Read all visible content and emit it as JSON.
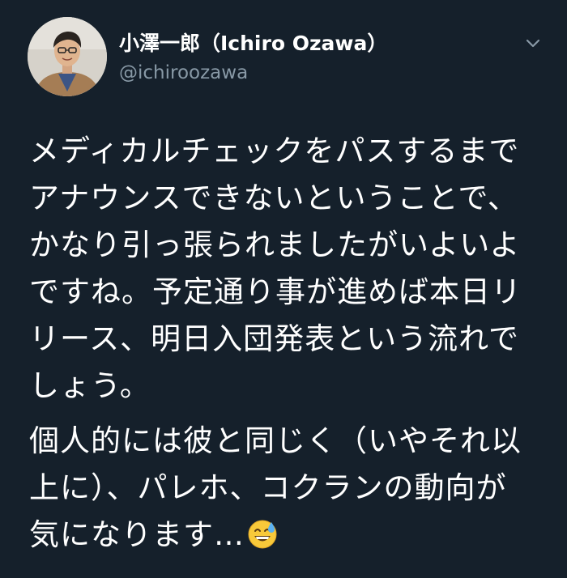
{
  "author": {
    "display_name": "小澤一郎（Ichiro Ozawa）",
    "handle": "@ichiroozawa"
  },
  "icons": {
    "avatar": "profile-photo",
    "menu": "chevron-down-icon",
    "emoji": "grinning-face-with-sweat-emoji"
  },
  "tweet": {
    "paragraph1_lines": [
      "メディカルチェックをパスするまで",
      "アナウンスできないということで、",
      "かなり引っ張られましたがいよいよ",
      "ですね。予定通り事が進めば本日リ",
      "リース、明日入団発表という流れで",
      "しょう。"
    ],
    "paragraph2_lines": [
      "個人的には彼と同じく（いやそれ以",
      "上に）、パレホ、コクランの動向が",
      "気になります…"
    ]
  },
  "colors": {
    "background": "#15202b",
    "text": "#ffffff",
    "secondary_text": "#8899a6"
  }
}
